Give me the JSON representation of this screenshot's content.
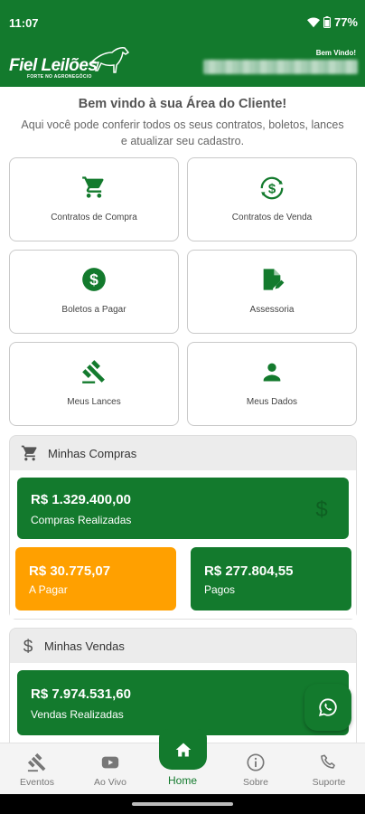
{
  "status_bar": {
    "time": "11:07",
    "battery": "77%"
  },
  "header": {
    "logo_text": "Fiel Leilões",
    "logo_subtext": "FORTE NO AGRONEGÓCIO",
    "welcome_label": "Bem Vindo!",
    "user_name": ""
  },
  "intro": {
    "title": "Bem vindo à sua Área do Cliente!",
    "subtitle": "Aqui você pode conferir todos os seus contratos, boletos, lances e atualizar seu cadastro."
  },
  "menu": [
    {
      "label": "Contratos de Compra",
      "icon": "cart-icon"
    },
    {
      "label": "Contratos de Venda",
      "icon": "currency-exchange-icon"
    },
    {
      "label": "Boletos a Pagar",
      "icon": "dollar-circle-icon"
    },
    {
      "label": "Assessoria",
      "icon": "document-edit-icon"
    },
    {
      "label": "Meus Lances",
      "icon": "gavel-icon"
    },
    {
      "label": "Meus Dados",
      "icon": "person-icon"
    }
  ],
  "compras": {
    "title": "Minhas Compras",
    "realizadas": {
      "amount": "R$ 1.329.400,00",
      "label": "Compras Realizadas"
    },
    "a_pagar": {
      "amount": "R$ 30.775,07",
      "label": "A Pagar"
    },
    "pagos": {
      "amount": "R$ 277.804,55",
      "label": "Pagos"
    }
  },
  "vendas": {
    "title": "Minhas Vendas",
    "realizadas": {
      "amount": "R$ 7.974.531,60",
      "label": "Vendas Realizadas"
    }
  },
  "bottom_nav": {
    "items": [
      {
        "label": "Eventos",
        "icon": "gavel-icon"
      },
      {
        "label": "Ao Vivo",
        "icon": "youtube-icon"
      },
      {
        "label": "Home",
        "icon": "home-icon"
      },
      {
        "label": "Sobre",
        "icon": "info-icon"
      },
      {
        "label": "Suporte",
        "icon": "phone-icon"
      }
    ]
  },
  "colors": {
    "primary": "#137a2d",
    "accent_orange": "#ffa000",
    "card_border": "#c9c9c9"
  }
}
